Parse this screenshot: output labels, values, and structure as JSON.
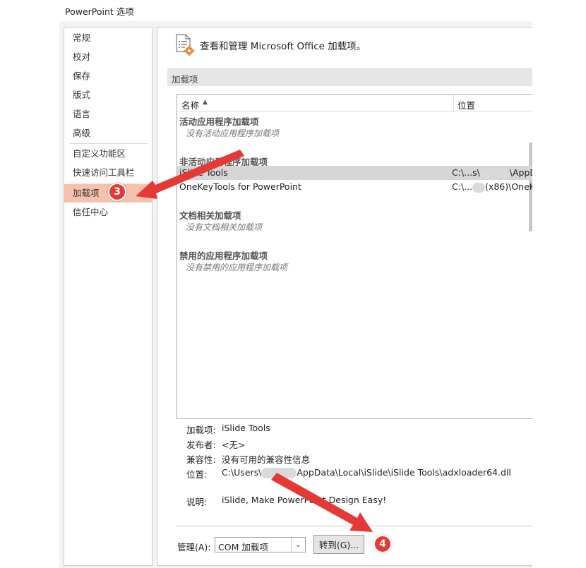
{
  "window": {
    "title": "PowerPoint 选项"
  },
  "nav": {
    "items": [
      "常规",
      "校对",
      "保存",
      "版式",
      "语言",
      "高级",
      "自定义功能区",
      "快速访问工具栏",
      "加载项",
      "信任中心"
    ],
    "active": "加载项"
  },
  "header": {
    "text": "查看和管理 Microsoft Office 加载项。",
    "icon": "addins-gear-icon"
  },
  "section": {
    "title": "加载项"
  },
  "list": {
    "columns": {
      "name": "名称",
      "location": "位置"
    },
    "groups": [
      {
        "title": "活动应用程序加载项",
        "empty": "没有活动应用程序加载项"
      },
      {
        "title": "非活动应用程序加载项",
        "rows": [
          {
            "name": "iSlide Tools",
            "location_prefix": "C:\\...s\\",
            "location_suffix": "\\AppD"
          },
          {
            "name": "OneKeyTools for PowerPoint",
            "location_prefix": "C:\\...",
            "location_suffix": "(x86)\\OneK"
          }
        ]
      },
      {
        "title": "文档相关加载项",
        "empty": "没有文档相关加载项"
      },
      {
        "title": "禁用的应用程序加载项",
        "empty": "没有禁用的应用程序加载项"
      }
    ],
    "selected": "iSlide Tools"
  },
  "details": {
    "addin_label": "加载项:",
    "addin_value": "iSlide Tools",
    "publisher_label": "发布者:",
    "publisher_value": "<无>",
    "compat_label": "兼容性:",
    "compat_value": "没有可用的兼容性信息",
    "location_label": "位置:",
    "location_prefix": "C:\\Users\\",
    "location_suffix": "AppData\\Local\\iSlide\\iSlide Tools\\adxloader64.dll",
    "desc_label": "说明:",
    "desc_value": "iSlide, Make PowerPoint Design Easy!"
  },
  "manage": {
    "label": "管理(A):",
    "selected": "COM 加载项",
    "go_button": "转到(G)..."
  },
  "annotations": {
    "step3": "3",
    "step4": "4",
    "color": "#e53935"
  },
  "colors": {
    "nav_active": "#f6c2ad",
    "row_selected": "#d6d6d6"
  }
}
